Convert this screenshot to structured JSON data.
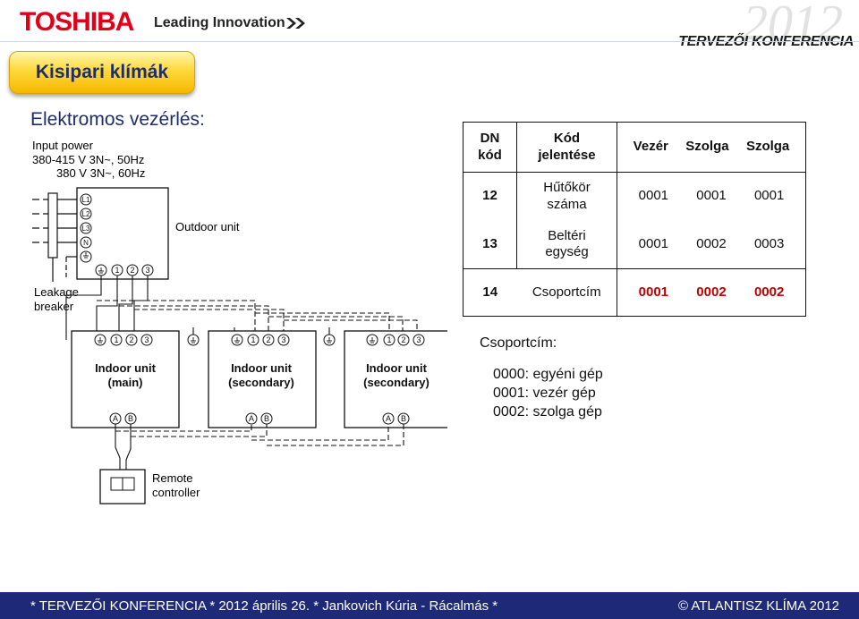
{
  "header": {
    "logo": "TOSHIBA",
    "tagline": "Leading Innovation",
    "year": "2012",
    "conference": "TERVEZŐI KONFERENCIA"
  },
  "title_button": "Kisipari klímák",
  "section_title": "Elektromos vezérlés:",
  "diagram": {
    "input_power": [
      "Input power",
      "380-415 V 3N~, 50Hz",
      "380 V 3N~, 60Hz"
    ],
    "outdoor_unit": "Outdoor unit",
    "leakage_breaker": [
      "Leakage",
      "breaker"
    ],
    "terminals_outdoor": [
      "L1",
      "L2",
      "L3",
      "N"
    ],
    "terminal_numbers": [
      "1",
      "2",
      "3"
    ],
    "indoor_units": [
      {
        "line1": "Indoor unit",
        "line2": "(main)"
      },
      {
        "line1": "Indoor unit",
        "line2": "(secondary)"
      },
      {
        "line1": "Indoor unit",
        "line2": "(secondary)"
      }
    ],
    "ab_labels": [
      "A",
      "B"
    ],
    "remote": [
      "Remote",
      "controller"
    ]
  },
  "table": {
    "headers": {
      "dn": [
        "DN",
        "kód"
      ],
      "meaning": [
        "Kód",
        "jelentése"
      ],
      "cols": [
        "Vezér",
        "Szolga",
        "Szolga"
      ]
    },
    "rows": [
      {
        "code": "12",
        "meaning": [
          "Hűtőkör",
          "száma"
        ],
        "values": [
          "0001",
          "0001",
          "0001"
        ]
      },
      {
        "code": "13",
        "meaning": [
          "Beltéri",
          "egység"
        ],
        "values": [
          "0001",
          "0002",
          "0003"
        ]
      },
      {
        "code": "14",
        "meaning": [
          "Csoportcím"
        ],
        "values": [
          "0001",
          "0002",
          "0002"
        ]
      }
    ]
  },
  "legend": {
    "title": "Csoportcím:",
    "items": [
      "0000: egyéni gép",
      "0001: vezér gép",
      "0002: szolga gép"
    ]
  },
  "footer": {
    "left": "* TERVEZŐI KONFERENCIA * 2012 április 26. * Jankovich Kúria - Rácalmás *",
    "right": "© ATLANTISZ KLÍMA 2012"
  }
}
